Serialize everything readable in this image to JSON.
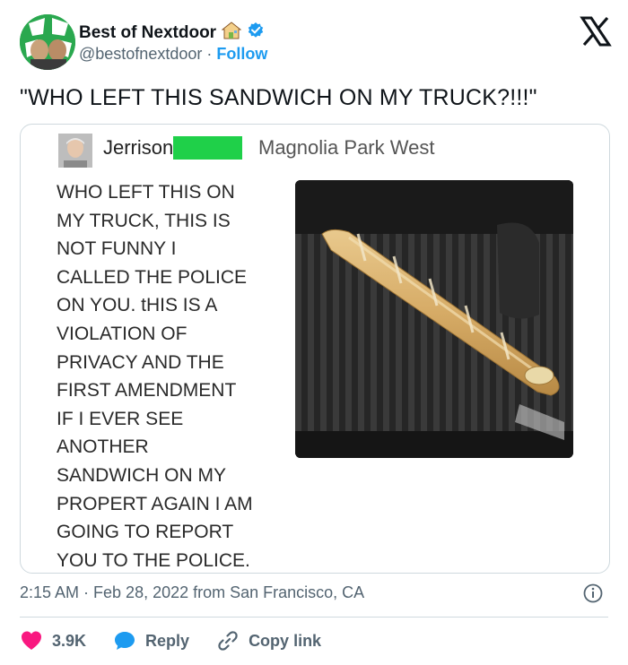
{
  "header": {
    "display_name": "Best of Nextdoor",
    "handle": "@bestofnextdoor",
    "separator": "·",
    "follow_label": "Follow"
  },
  "tweet": {
    "text": "\"WHO LEFT THIS SANDWICH ON MY TRUCK?!!!\""
  },
  "embedded_post": {
    "author": "Jerrison",
    "neighborhood": "Magnolia Park West",
    "body_lines": [
      "WHO LEFT THIS ON",
      "MY TRUCK, THIS IS",
      "NOT FUNNY I",
      "CALLED THE POLICE",
      "ON YOU. tHIS IS A",
      "VIOLATION OF",
      "PRIVACY AND THE",
      "FIRST AMENDMENT",
      "IF I EVER SEE",
      "ANOTHER",
      "SANDWICH ON MY",
      "PROPERT AGAIN I AM",
      "GOING TO REPORT",
      "YOU TO THE POLICE."
    ]
  },
  "meta": {
    "timestamp": "2:15 AM · Feb 28, 2022 from San Francisco, CA"
  },
  "actions": {
    "likes": "3.9K",
    "reply_label": "Reply",
    "copy_link_label": "Copy link"
  },
  "colors": {
    "accent": "#1d9bf0",
    "heart": "#f91880",
    "verified": "#1d9bf0",
    "redaction": "#1fd049",
    "text_secondary": "#536471"
  },
  "icons": {
    "verified": "verified-badge-icon",
    "house": "house-emoji-icon",
    "x_logo": "x-logo-icon",
    "info": "info-icon",
    "heart": "heart-icon",
    "reply": "speech-bubble-icon",
    "copy_link": "link-icon"
  }
}
